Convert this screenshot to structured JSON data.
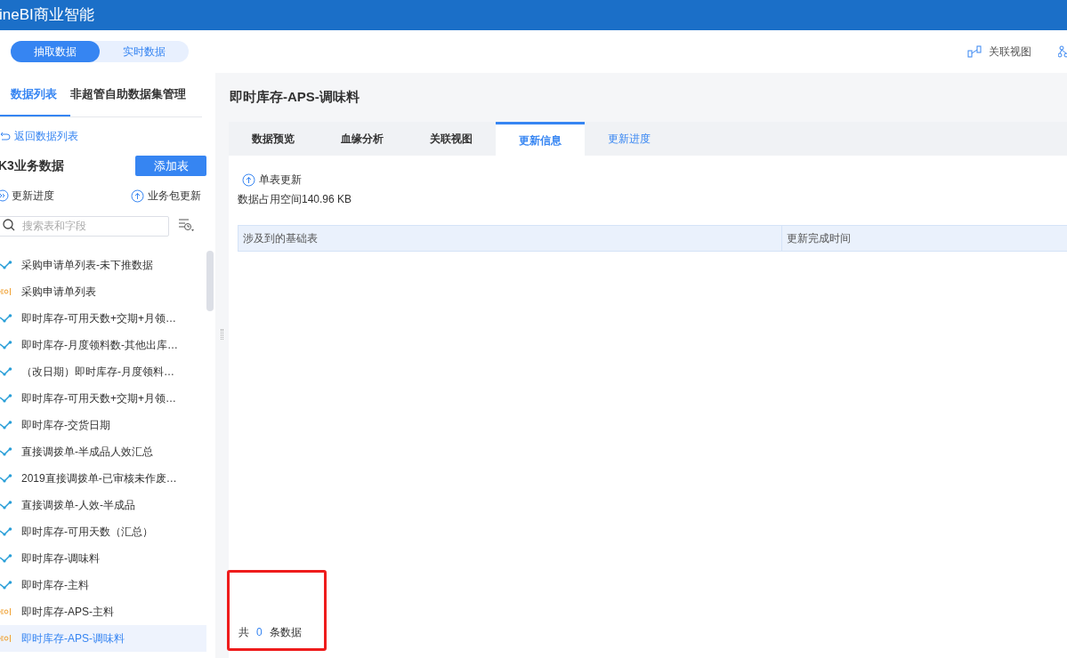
{
  "app": {
    "title": "ineBI商业智能"
  },
  "mode_toggle": [
    {
      "label": "抽取数据",
      "selected": true
    },
    {
      "label": "实时数据",
      "selected": false
    }
  ],
  "top_actions": [
    {
      "label": "关联视图"
    }
  ],
  "sidebar": {
    "tabs": [
      {
        "label": "数据列表",
        "selected": true
      },
      {
        "label": "非超管自助数据集管理",
        "selected": false
      }
    ],
    "back_link": "返回数据列表",
    "group_title": "K3业务数据",
    "add_button": "添加表",
    "progress_link": "更新进度",
    "package_update": "业务包更新",
    "search": {
      "placeholder": "搜索表和字段"
    },
    "items": [
      {
        "kind": "etl",
        "label": "采购申请单列表-未下推数据",
        "selected": false
      },
      {
        "kind": "sql",
        "label": "采购申请单列表",
        "selected": false
      },
      {
        "kind": "etl",
        "label": "即时库存-可用天数+交期+月领…",
        "selected": false
      },
      {
        "kind": "etl",
        "label": "即时库存-月度领料数-其他出库…",
        "selected": false
      },
      {
        "kind": "etl",
        "label": "（改日期）即时库存-月度领料…",
        "selected": false
      },
      {
        "kind": "etl",
        "label": "即时库存-可用天数+交期+月领…",
        "selected": false
      },
      {
        "kind": "etl",
        "label": "即时库存-交货日期",
        "selected": false
      },
      {
        "kind": "etl",
        "label": "直接调拨单-半成品人效汇总",
        "selected": false
      },
      {
        "kind": "etl",
        "label": "2019直接调拨单-已审核未作废…",
        "selected": false
      },
      {
        "kind": "etl",
        "label": "直接调拨单-人效-半成品",
        "selected": false
      },
      {
        "kind": "etl",
        "label": "即时库存-可用天数（汇总）",
        "selected": false
      },
      {
        "kind": "etl",
        "label": "即时库存-调味料",
        "selected": false
      },
      {
        "kind": "etl",
        "label": "即时库存-主料",
        "selected": false
      },
      {
        "kind": "sql",
        "label": "即时库存-APS-主料",
        "selected": false
      },
      {
        "kind": "sql",
        "label": "即时库存-APS-调味料",
        "selected": true
      }
    ]
  },
  "main": {
    "title": "即时库存-APS-调味料",
    "tabs": [
      {
        "label": "数据预览",
        "selected": false,
        "kind": "main"
      },
      {
        "label": "血缘分析",
        "selected": false,
        "kind": "main"
      },
      {
        "label": "关联视图",
        "selected": false,
        "kind": "main"
      },
      {
        "label": "更新信息",
        "selected": true,
        "kind": "main"
      },
      {
        "label": "更新进度",
        "selected": false,
        "kind": "link"
      }
    ],
    "single_update": "单表更新",
    "space_info": "数据占用空间140.96 KB",
    "table": {
      "columns": [
        "涉及到的基础表",
        "更新完成时间"
      ]
    },
    "pagination": {
      "prefix": "共",
      "count": "0",
      "suffix": "条数据"
    }
  }
}
